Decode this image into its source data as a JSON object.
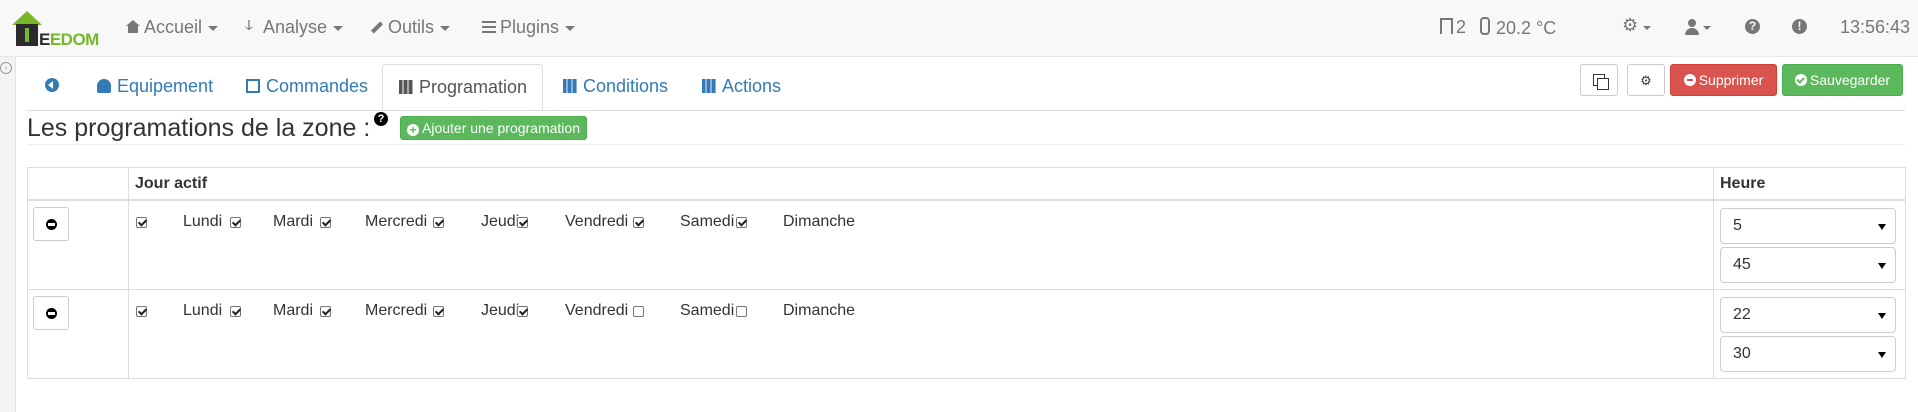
{
  "brand": {
    "logo_text_dark": "E",
    "logo_text_green": "EDOM"
  },
  "nav": {
    "items": [
      {
        "label": "Accueil",
        "icon": "home-icon"
      },
      {
        "label": "Analyse",
        "icon": "pulse-icon"
      },
      {
        "label": "Outils",
        "icon": "wrench-icon"
      },
      {
        "label": "Plugins",
        "icon": "plugins-icon"
      }
    ],
    "status": {
      "doors_open": "2",
      "temperature": "20.2 °C"
    },
    "clock": "13:56:43",
    "help_glyph": "?",
    "info_glyph": "!"
  },
  "tabs": [
    {
      "label": "",
      "icon": "back-icon",
      "active": false
    },
    {
      "label": "Equipement",
      "icon": "gauge-icon",
      "active": false
    },
    {
      "label": "Commandes",
      "icon": "list-icon",
      "active": false
    },
    {
      "label": "Programation",
      "icon": "map-icon",
      "active": true
    },
    {
      "label": "Conditions",
      "icon": "map-icon",
      "active": false
    },
    {
      "label": "Actions",
      "icon": "map-icon",
      "active": false
    }
  ],
  "toolbar": {
    "delete_label": "Supprimer",
    "save_label": "Sauvegarder"
  },
  "section": {
    "title": "Les programations de la zone :",
    "help_glyph": "?",
    "add_label": "Ajouter une programation"
  },
  "table": {
    "headers": {
      "days": "Jour actif",
      "hour": "Heure"
    },
    "days": [
      "Lundi",
      "Mardi",
      "Mercredi",
      "Jeudi",
      "Vendredi",
      "Samedi",
      "Dimanche"
    ],
    "rows": [
      {
        "checks": [
          true,
          true,
          true,
          true,
          true,
          true,
          true
        ],
        "hour": "5",
        "minute": "45"
      },
      {
        "checks": [
          true,
          true,
          true,
          true,
          true,
          false,
          false
        ],
        "hour": "22",
        "minute": "30"
      }
    ]
  },
  "colors": {
    "primary": "#337ab7",
    "danger": "#d9534f",
    "success": "#5cb85c",
    "brand_green": "#77b82a"
  }
}
